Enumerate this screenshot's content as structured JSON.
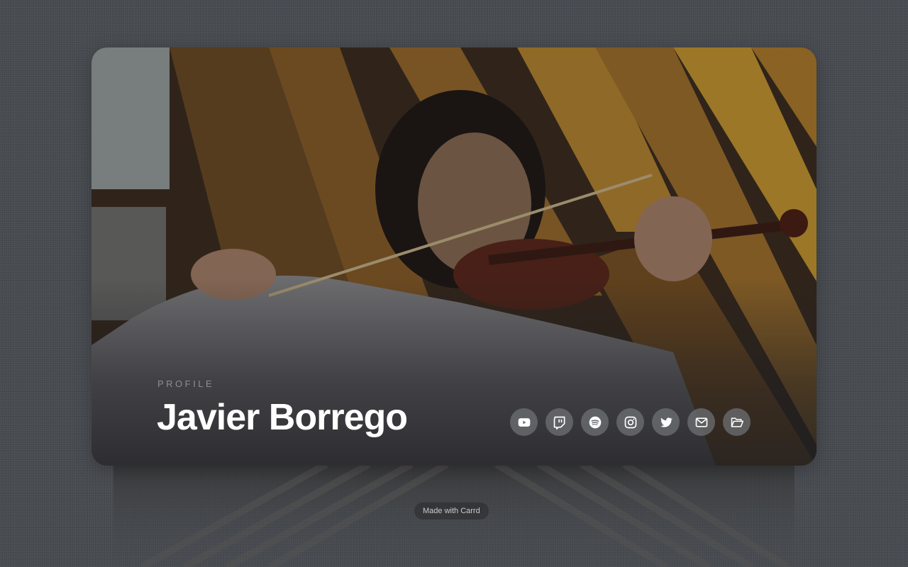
{
  "profile": {
    "eyebrow": "PROFILE",
    "name": "Javier Borrego"
  },
  "social": [
    {
      "icon": "youtube-icon"
    },
    {
      "icon": "twitch-icon"
    },
    {
      "icon": "spotify-icon"
    },
    {
      "icon": "instagram-icon"
    },
    {
      "icon": "twitter-icon"
    },
    {
      "icon": "mail-icon"
    },
    {
      "icon": "folder-open-icon"
    }
  ],
  "footer": {
    "made_with": "Made with Carrd"
  },
  "colors": {
    "page_background": "#474b50",
    "name_text": "#ffffff",
    "eyebrow_text": "#8c8f94",
    "icon_button": "#6e7074"
  }
}
